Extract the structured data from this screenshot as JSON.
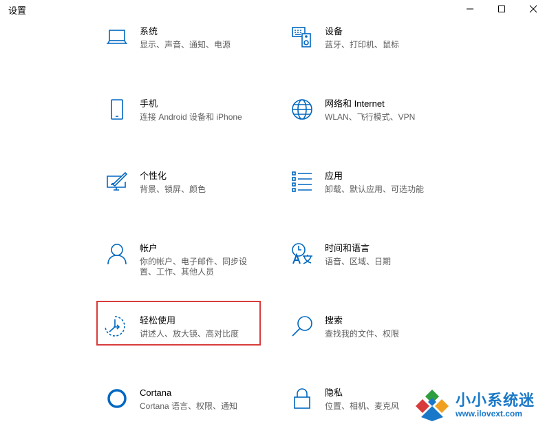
{
  "window": {
    "title": "设置",
    "controls": [
      "minimize-icon",
      "maximize-icon",
      "close-icon"
    ]
  },
  "accent_color": "#0067c0",
  "highlight_color": "#d83b3b",
  "settings": [
    {
      "id": "system",
      "icon": "laptop-icon",
      "name": "系统",
      "desc": "显示、声音、通知、电源",
      "desc2": ""
    },
    {
      "id": "devices",
      "icon": "keyboard-speaker-icon",
      "name": "设备",
      "desc": "蓝牙、打印机、鼠标",
      "desc2": ""
    },
    {
      "id": "phone",
      "icon": "phone-icon",
      "name": "手机",
      "desc": "连接 Android 设备和 iPhone",
      "desc2": ""
    },
    {
      "id": "network",
      "icon": "globe-icon",
      "name": "网络和 Internet",
      "desc": "WLAN、飞行模式、VPN",
      "desc2": ""
    },
    {
      "id": "personalization",
      "icon": "paint-screen-icon",
      "name": "个性化",
      "desc": "背景、锁屏、颜色",
      "desc2": ""
    },
    {
      "id": "apps",
      "icon": "apps-list-icon",
      "name": "应用",
      "desc": "卸载、默认应用、可选功能",
      "desc2": ""
    },
    {
      "id": "accounts",
      "icon": "person-icon",
      "name": "帐户",
      "desc": "你的帐户、电子邮件、同步设",
      "desc2": "置、工作、其他人员"
    },
    {
      "id": "time-language",
      "icon": "time-language-icon",
      "name": "时间和语言",
      "desc": "语音、区域、日期",
      "desc2": ""
    },
    {
      "id": "ease-of-access",
      "icon": "ease-of-access-icon",
      "name": "轻松使用",
      "desc": "讲述人、放大镜、高对比度",
      "desc2": ""
    },
    {
      "id": "search",
      "icon": "magnifier-icon",
      "name": "搜索",
      "desc": "查找我的文件、权限",
      "desc2": ""
    },
    {
      "id": "cortana",
      "icon": "cortana-ring-icon",
      "name": "Cortana",
      "desc": "Cortana 语言、权限、通知",
      "desc2": ""
    },
    {
      "id": "privacy",
      "icon": "lock-icon",
      "name": "隐私",
      "desc": "位置、相机、麦克风",
      "desc2": ""
    }
  ],
  "watermark": {
    "title": "小小系统迷",
    "url": "www.ilovext.com"
  }
}
